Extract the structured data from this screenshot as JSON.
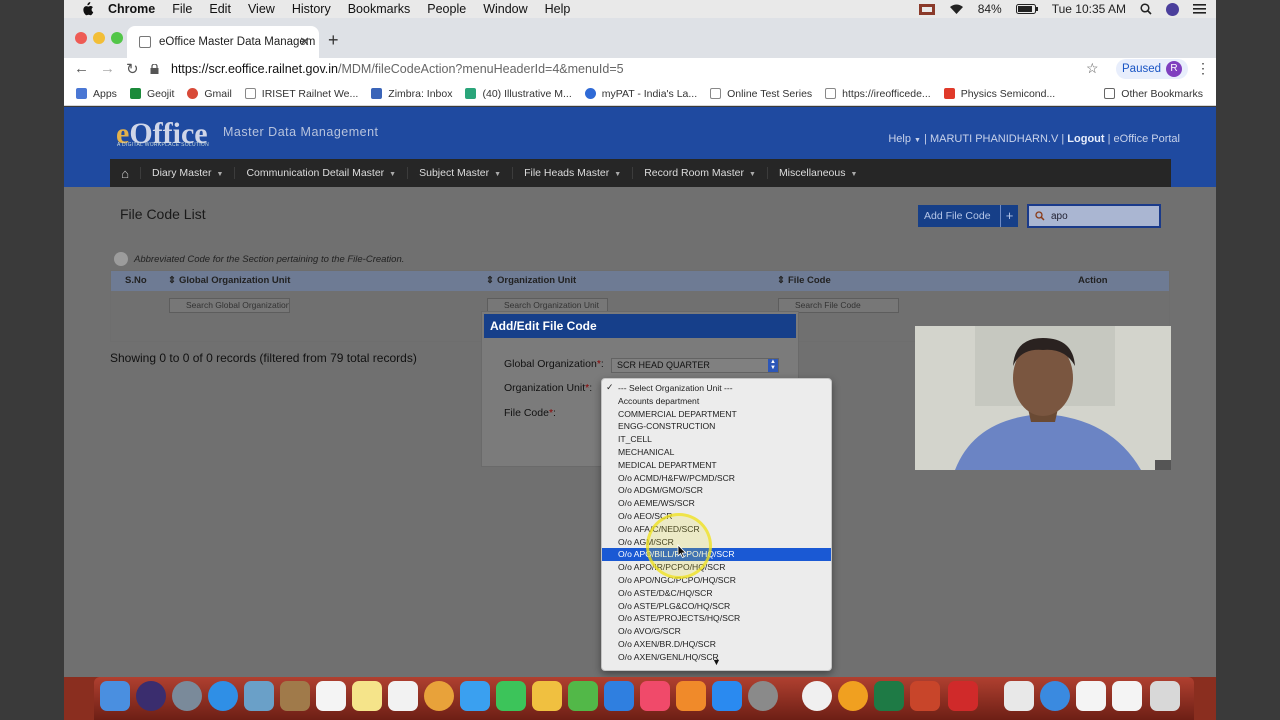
{
  "menubar": {
    "app": "Chrome",
    "items": [
      "File",
      "Edit",
      "View",
      "History",
      "Bookmarks",
      "People",
      "Window",
      "Help"
    ],
    "battery": "84%",
    "clock": "Tue 10:35 AM"
  },
  "browser": {
    "tab_title": "eOffice Master Data Managem",
    "url_host": "https://scr.eoffice.railnet.gov.in",
    "url_path": "/MDM/fileCodeAction?menuHeaderId=4&menuId=5",
    "profile_status": "Paused",
    "profile_initial": "R",
    "bookmarks": [
      {
        "label": "Apps",
        "color": "#4a77d4"
      },
      {
        "label": "Geojit",
        "color": "#1b8a3a"
      },
      {
        "label": "Gmail",
        "color": "#d84a38"
      },
      {
        "label": "IRISET Railnet We...",
        "color": "#888888"
      },
      {
        "label": "Zimbra: Inbox",
        "color": "#3a64b8"
      },
      {
        "label": "(40) Illustrative M...",
        "color": "#2aa57a"
      },
      {
        "label": "myPAT - India's La...",
        "color": "#2f6ad6"
      },
      {
        "label": "Online Test Series",
        "color": "#888888"
      },
      {
        "label": "https://ireofficede...",
        "color": "#888888"
      },
      {
        "label": "Physics Semicond...",
        "color": "#e03a2a"
      }
    ],
    "other_bookmarks": "Other Bookmarks"
  },
  "header": {
    "logo_e": "e",
    "logo_rest": "Office",
    "logo_tagline": "A DIGITAL WORKPLACE SOLUTION",
    "subtitle": "Master Data Management",
    "help": "Help",
    "user": "MARUTI PHANIDHARN.V",
    "logout": "Logout",
    "portal": "eOffice Portal"
  },
  "nav": [
    "Diary Master",
    "Communication Detail Master",
    "Subject Master",
    "File Heads Master",
    "Record Room Master",
    "Miscellaneous"
  ],
  "main": {
    "title": "File Code List",
    "add_button": "Add File Code",
    "search_value": "apo",
    "note": "Abbreviated Code for the Section pertaining to the File-Creation.",
    "columns": [
      "S.No",
      "Global Organization Unit",
      "Organization Unit",
      "File Code",
      "Action"
    ],
    "filter_placeholders": [
      "Search Global Organization Unit",
      "Search Organization Unit",
      "Search File Code"
    ],
    "records": "Showing 0 to 0 of 0 records (filtered from 79 total records)"
  },
  "modal": {
    "title": "Add/Edit File Code",
    "global_org_label": "Global Organization",
    "global_org_value": "SCR HEAD QUARTER",
    "org_unit_label": "Organization Unit",
    "file_code_label": "File Code"
  },
  "dropdown": {
    "options": [
      "--- Select Organization Unit ---",
      "Accounts department",
      "COMMERCIAL DEPARTMENT",
      "ENGG-CONSTRUCTION",
      "IT_CELL",
      "MECHANICAL",
      "MEDICAL DEPARTMENT",
      "O/o ACMD/H&FW/PCMD/SCR",
      "O/o ADGM/GMO/SCR",
      "O/o AEME/WS/SCR",
      "O/o AEO/SCR",
      "O/o AFA/C/NED/SCR",
      "O/o AGM/SCR",
      "O/o APO/BILL/PCPO/HQ/SCR",
      "O/o APO/IR/PCPO/HQ/SCR",
      "O/o APO/NGC/PCPO/HQ/SCR",
      "O/o ASTE/D&C/HQ/SCR",
      "O/o ASTE/PLG&CO/HQ/SCR",
      "O/o ASTE/PROJECTS/HQ/SCR",
      "O/o AVO/G/SCR",
      "O/o AXEN/BR.D/HQ/SCR",
      "O/o AXEN/GENL/HQ/SCR"
    ],
    "checked_index": 0,
    "highlighted_index": 13
  }
}
